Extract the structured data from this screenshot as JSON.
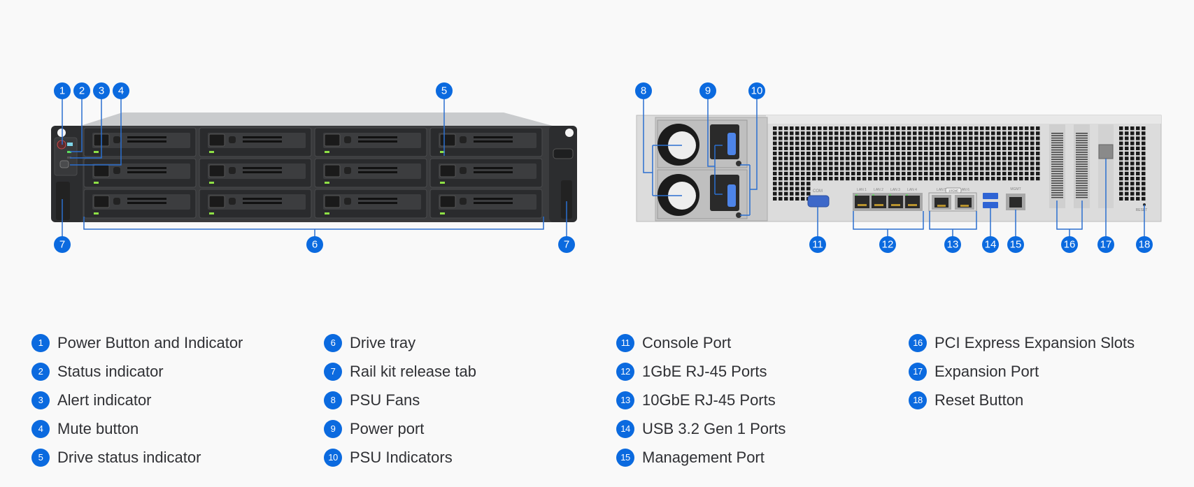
{
  "diagram": {
    "front_view": {
      "callouts": [
        "1",
        "2",
        "3",
        "4",
        "5",
        "6",
        "7",
        "7"
      ]
    },
    "rear_view": {
      "callouts": [
        "8",
        "9",
        "10",
        "11",
        "12",
        "13",
        "14",
        "15",
        "16",
        "17",
        "18"
      ],
      "port_labels": {
        "com": "COM",
        "lan": [
          "LAN 1",
          "LAN 2",
          "LAN 3",
          "LAN 4"
        ],
        "lan10g": [
          "LAN 5",
          "LAN 6"
        ],
        "lan10g_badge": "10GbE",
        "mgmt": "MGMT",
        "reset": "RESET"
      }
    },
    "colors": {
      "callout": "#0b6adf",
      "leader_line": "#2b6fd0",
      "background": "#f9f9f9",
      "legend_text": "#2f3034"
    }
  },
  "legend": {
    "columns": [
      [
        {
          "num": "1",
          "label": "Power Button and Indicator"
        },
        {
          "num": "2",
          "label": "Status indicator"
        },
        {
          "num": "3",
          "label": "Alert indicator"
        },
        {
          "num": "4",
          "label": "Mute button"
        },
        {
          "num": "5",
          "label": "Drive status indicator"
        }
      ],
      [
        {
          "num": "6",
          "label": "Drive tray"
        },
        {
          "num": "7",
          "label": "Rail kit release tab"
        },
        {
          "num": "8",
          "label": "PSU Fans"
        },
        {
          "num": "9",
          "label": "Power port"
        },
        {
          "num": "10",
          "label": "PSU Indicators"
        }
      ],
      [
        {
          "num": "11",
          "label": "Console Port"
        },
        {
          "num": "12",
          "label": "1GbE RJ-45 Ports"
        },
        {
          "num": "13",
          "label": "10GbE RJ-45 Ports"
        },
        {
          "num": "14",
          "label": "USB 3.2 Gen 1 Ports"
        },
        {
          "num": "15",
          "label": "Management Port"
        }
      ],
      [
        {
          "num": "16",
          "label": "PCI Express Expansion Slots"
        },
        {
          "num": "17",
          "label": "Expansion Port"
        },
        {
          "num": "18",
          "label": "Reset Button"
        }
      ]
    ]
  }
}
